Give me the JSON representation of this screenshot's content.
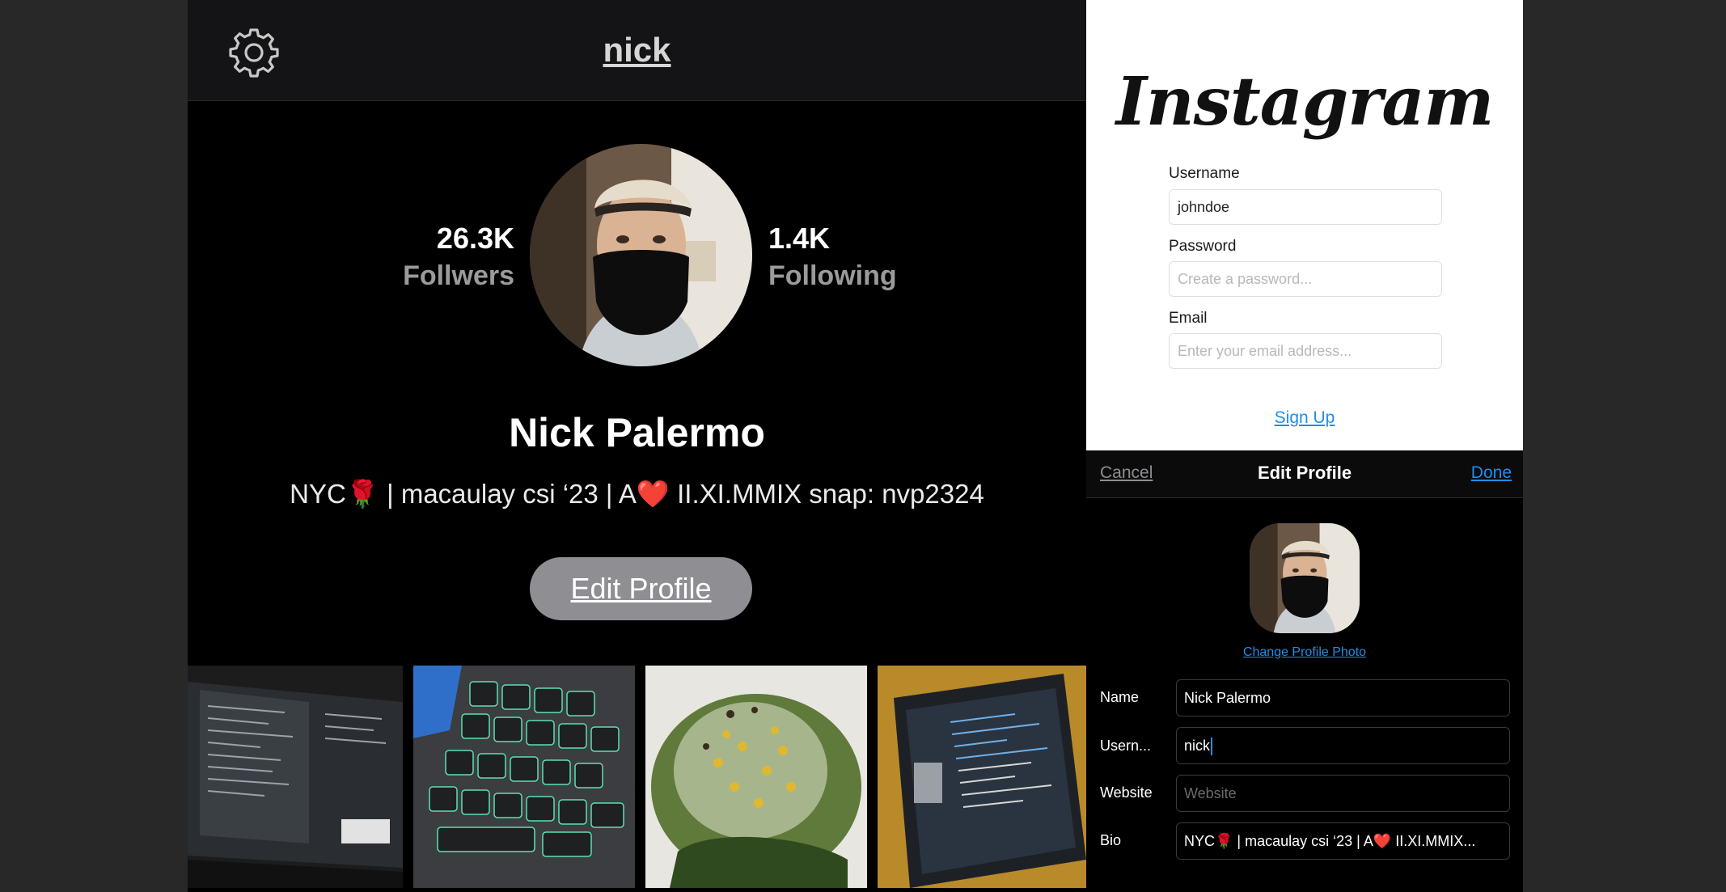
{
  "profile": {
    "nav_username": "nick",
    "followers_count": "26.3K",
    "followers_label": "Follwers",
    "following_count": "1.4K",
    "following_label": "Following",
    "full_name": "Nick Palermo",
    "bio": "NYC🌹 | macaulay csi ‘23 | A❤️ II.XI.MMIX snap: nvp2324",
    "edit_button": "Edit Profile",
    "icons": {
      "settings": "gear-icon"
    },
    "grid_tiles": [
      "laptop-code-photo",
      "keyboard-photo",
      "salad-photo",
      "laptop-editor-photo"
    ]
  },
  "signup": {
    "logo": "Instagram",
    "username_label": "Username",
    "username_value": "johndoe",
    "password_label": "Password",
    "password_placeholder": "Create a password...",
    "email_label": "Email",
    "email_placeholder": "Enter your email address...",
    "signup_link": "Sign Up"
  },
  "edit_sheet": {
    "cancel": "Cancel",
    "title": "Edit Profile",
    "done": "Done",
    "change_photo": "Change Profile Photo",
    "name_label": "Name",
    "name_value": "Nick Palermo",
    "username_label": "Usern...",
    "username_value": "nick",
    "website_label": "Website",
    "website_placeholder": "Website",
    "bio_label": "Bio",
    "bio_value": "NYC🌹 | macaulay csi ‘23 | A❤️ II.XI.MMIX..."
  },
  "colors": {
    "accent_link": "#1e8ee8",
    "page_background": "#282828",
    "profile_background": "#000000",
    "button_gray": "#8e8e93"
  }
}
